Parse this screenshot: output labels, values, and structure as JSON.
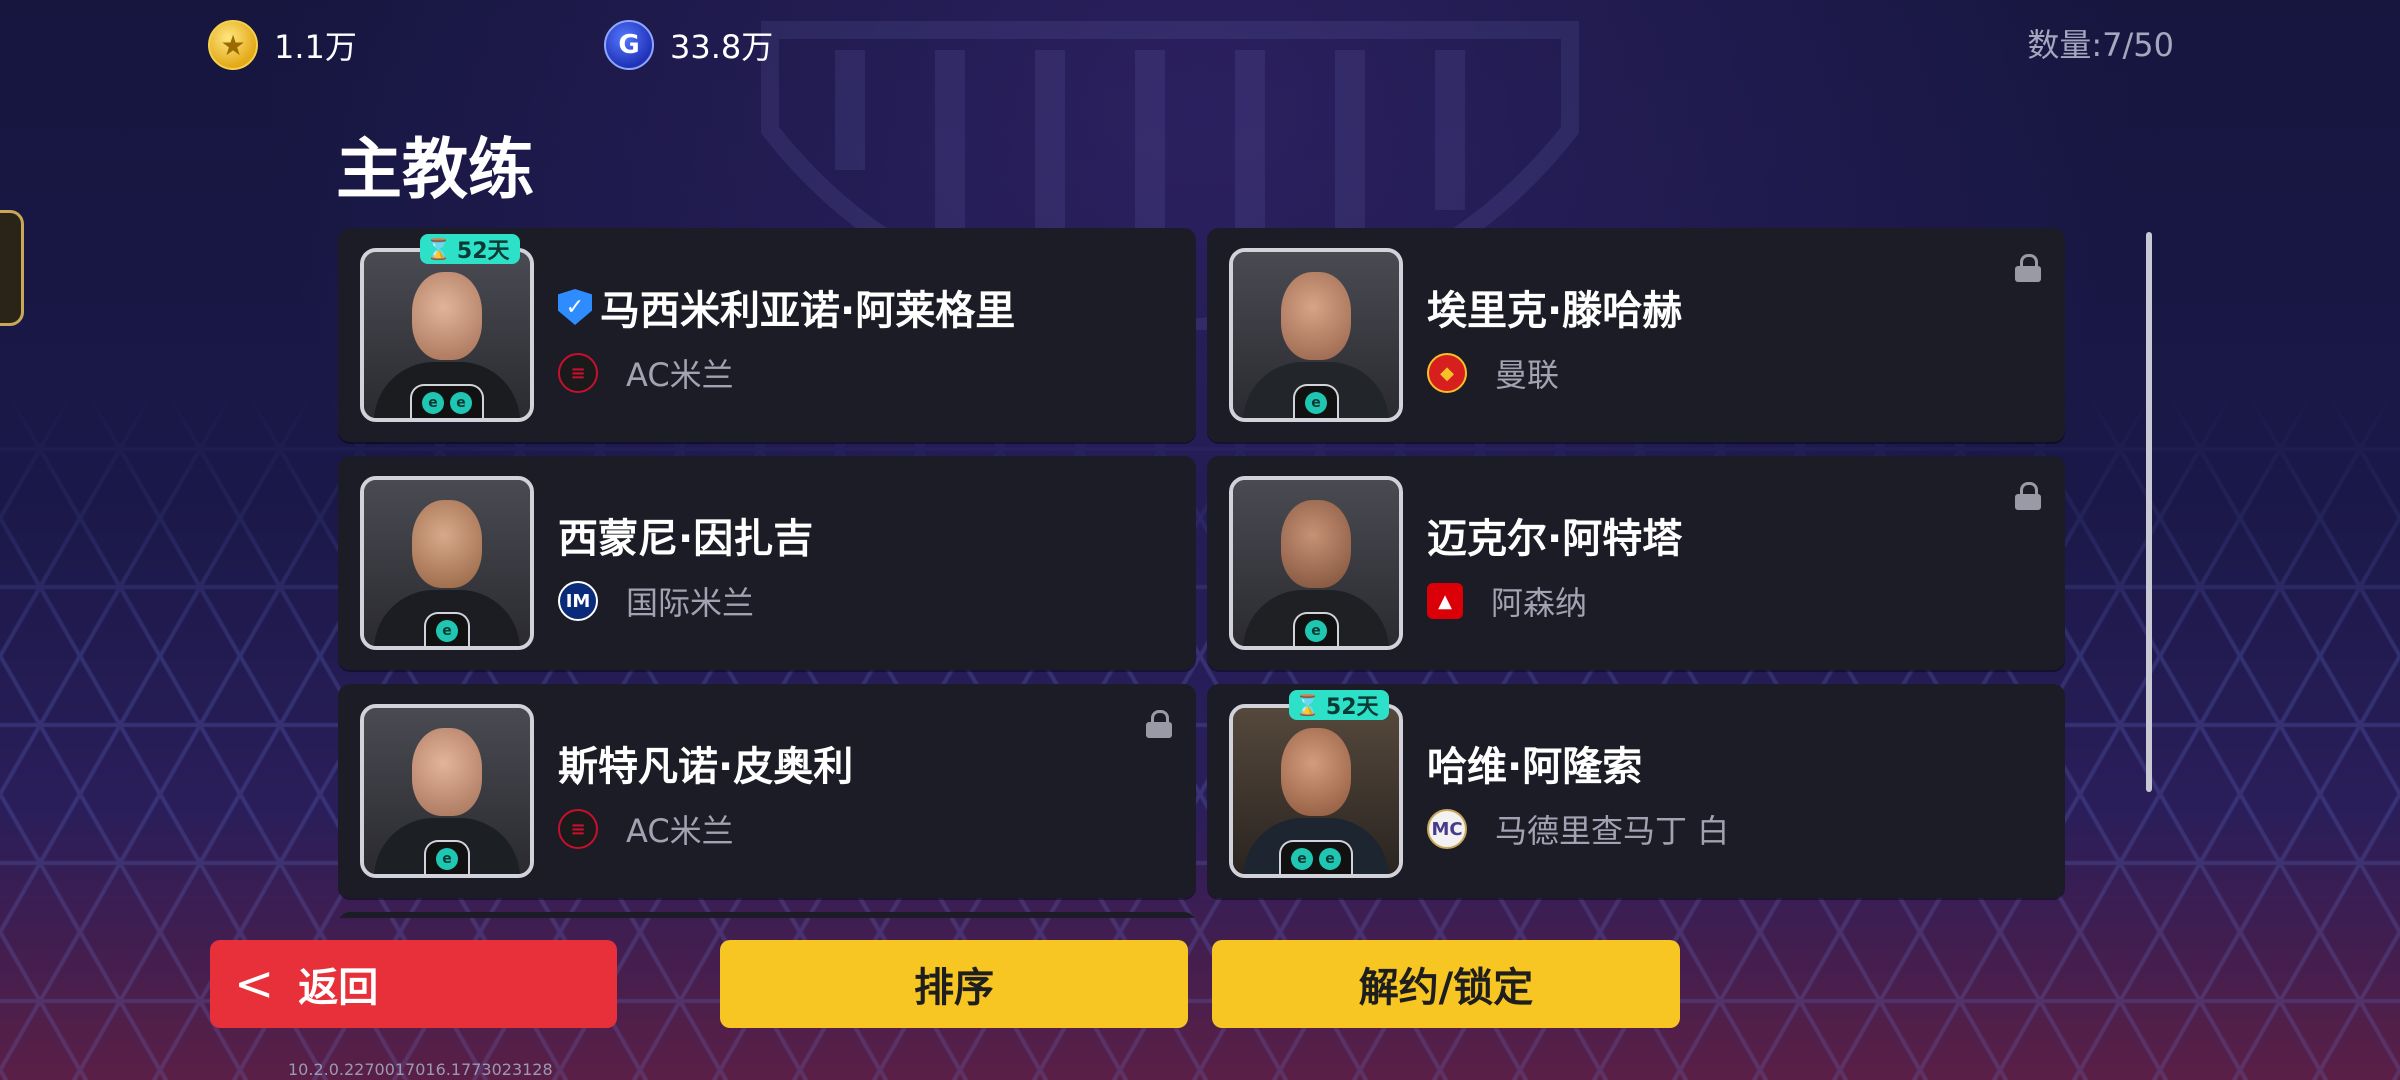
{
  "currencies": [
    {
      "icon": "gold-coin-icon",
      "value": "1.1万"
    },
    {
      "icon": "gp-coin-icon",
      "value": "33.8万"
    }
  ],
  "count_label": "数量:7/50",
  "page_title": "主教练",
  "coaches": [
    {
      "name": "马西米利亚诺·阿莱格里",
      "club": "AC米兰",
      "club_icon": "ac-milan-crest-icon",
      "days": "52天",
      "verified": true,
      "locked": false
    },
    {
      "name": "埃里克·滕哈赫",
      "club": "曼联",
      "club_icon": "man-united-crest-icon",
      "days": null,
      "verified": false,
      "locked": true
    },
    {
      "name": "西蒙尼·因扎吉",
      "club": "国际米兰",
      "club_icon": "inter-crest-icon",
      "days": null,
      "verified": false,
      "locked": false
    },
    {
      "name": "迈克尔·阿特塔",
      "club": "阿森纳",
      "club_icon": "arsenal-crest-icon",
      "days": null,
      "verified": false,
      "locked": true
    },
    {
      "name": "斯特凡诺·皮奥利",
      "club": "AC米兰",
      "club_icon": "ac-milan-crest-icon",
      "days": null,
      "verified": false,
      "locked": true
    },
    {
      "name": "哈维·阿隆索",
      "club": "马德里查马丁 白",
      "club_icon": "madrid-chamartin-crest-icon",
      "days": "52天",
      "verified": false,
      "locked": false
    }
  ],
  "buttons": {
    "back": "返回",
    "sort": "排序",
    "release_lock": "解约/锁定"
  },
  "version": "10.2.0.2270017016.1773023128",
  "colors": {
    "accent_yellow": "#f8c622",
    "back_red": "#e8303a",
    "badge_teal": "#2de1c9",
    "card_bg": "#1c1c26"
  }
}
